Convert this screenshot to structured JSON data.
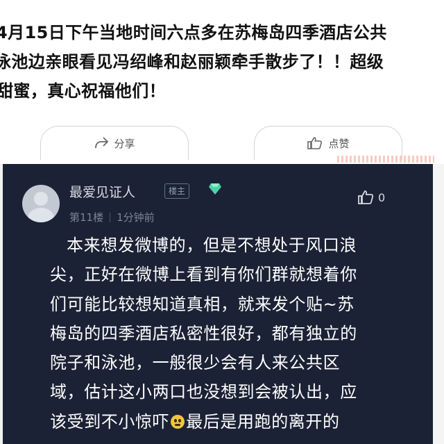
{
  "top_post": {
    "lines": [
      "4月15日下午当地时间六点多在苏梅岛四季酒店公共",
      "泳池边亲眼看见冯绍峰和赵丽颖牵手散步了！！超级",
      "甜蜜，真心祝福他们！"
    ],
    "share_label": "分享",
    "share_icon": "share-icon",
    "like_label": "点赞",
    "like_icon": "thumbs-up-icon"
  },
  "comment": {
    "username": "最爱见证人",
    "op_badge": "楼主",
    "floor": "第11楼",
    "time": "1分钟前",
    "like_count": "0",
    "like_icon": "thumbs-up-icon",
    "avatar_icon": "default-avatar",
    "badge_icon": "diamond-icon",
    "lines": [
      "本来想发微博的，但是不想处于风口浪",
      "尖，正好在微博上看到有你们群就想着你",
      "们可能比较想知道真相，就来发个贴~苏",
      "梅岛的四季酒店私密性很好，都有独立的",
      "院子和泳池，一般很少会有人来公共区",
      "域，估计这小两口也没想到会被认出，应"
    ],
    "last_line_before_emoji": "该受到不小惊吓",
    "last_line_after_emoji": "最后是用跑的离开的"
  },
  "colors": {
    "dark_bg": "#1b2235",
    "text_white": "#ffffff",
    "muted": "#7b8496",
    "gem": "#4fd1a8"
  }
}
